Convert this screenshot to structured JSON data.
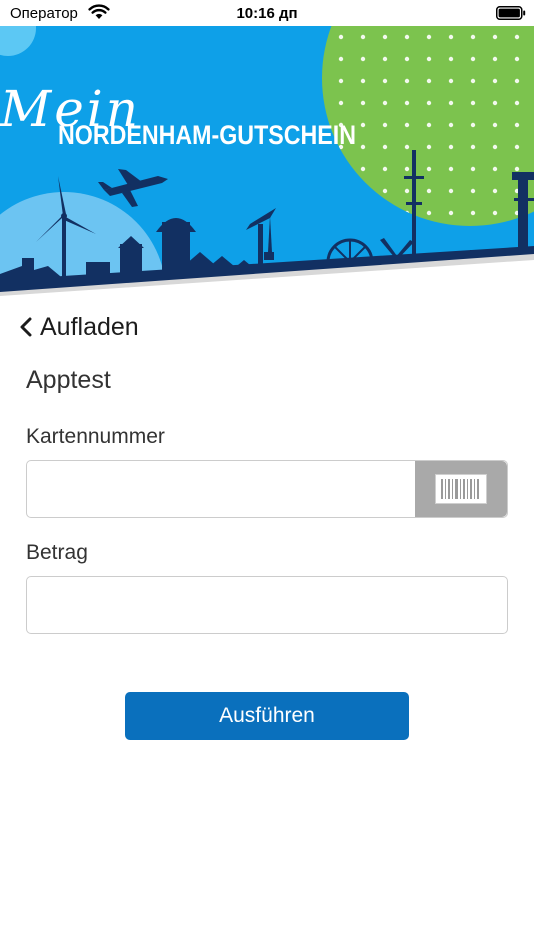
{
  "status_bar": {
    "carrier": "Оператор",
    "time": "10:16 дп"
  },
  "banner": {
    "script_text": "Mein",
    "title": "NORDENHAM-GUTSCHEIN"
  },
  "nav": {
    "back_label": "Aufladen"
  },
  "form": {
    "title": "Apptest",
    "card_label": "Kartennummer",
    "card_value": "",
    "amount_label": "Betrag",
    "amount_value": "",
    "submit_label": "Ausführen"
  },
  "colors": {
    "banner_blue": "#0ea0e8",
    "banner_green": "#7cc34e",
    "skyline_navy": "#123062",
    "submit_blue": "#0a70bd",
    "scan_gray": "#a9a9a9"
  },
  "icons": [
    "wifi-icon",
    "battery-icon",
    "chevron-left-icon",
    "barcode-icon"
  ]
}
